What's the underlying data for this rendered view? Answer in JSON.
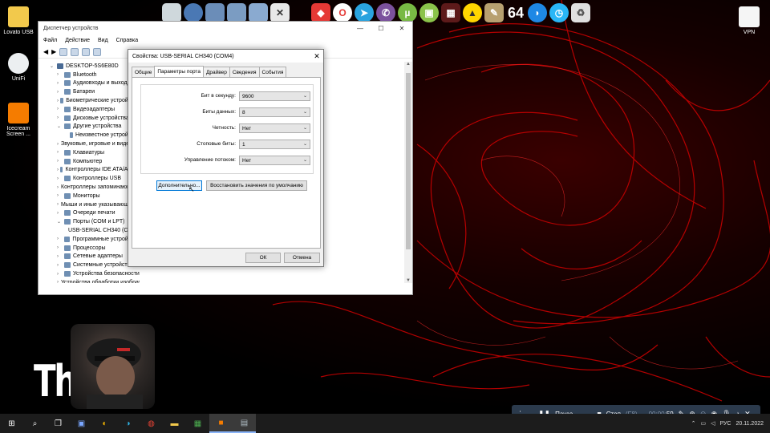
{
  "desktop": {
    "icons": [
      {
        "label": "Lovato USB"
      },
      {
        "label": "UniFi"
      },
      {
        "label": "Icecream Screen ..."
      },
      {
        "label": "VPN"
      }
    ],
    "dock_icons": [
      "files-icon",
      "globe-icon",
      "folder-icon",
      "folder-icon",
      "folder-icon",
      "tools-icon",
      "anydesk-icon",
      "opera-icon",
      "telegram-icon",
      "viber-icon",
      "utorrent-icon",
      "android-icon",
      "film-icon",
      "arrow-icon",
      "scanner-icon",
      "64-icon",
      "shark-icon",
      "timer-icon",
      "recycle-icon"
    ],
    "dock_64_label": "64"
  },
  "devmgr": {
    "title": "Диспетчер устройств",
    "menu": [
      "Файл",
      "Действие",
      "Вид",
      "Справка"
    ],
    "root": "DESKTOP-5S6E80D",
    "tree": [
      {
        "label": "Bluetooth",
        "exp": "›",
        "indent": 1
      },
      {
        "label": "Аудиовходы и выходы",
        "exp": "›",
        "indent": 1
      },
      {
        "label": "Батареи",
        "exp": "›",
        "indent": 1
      },
      {
        "label": "Биометрические устройства",
        "exp": "›",
        "indent": 1
      },
      {
        "label": "Видеоадаптеры",
        "exp": "›",
        "indent": 1
      },
      {
        "label": "Дисковые устройства",
        "exp": "›",
        "indent": 1
      },
      {
        "label": "Другие устройства",
        "exp": "⌄",
        "indent": 1
      },
      {
        "label": "Неизвестное устройство",
        "exp": "",
        "indent": 2
      },
      {
        "label": "Звуковые, игровые и видеоустройства",
        "exp": "›",
        "indent": 1
      },
      {
        "label": "Клавиатуры",
        "exp": "›",
        "indent": 1
      },
      {
        "label": "Компьютер",
        "exp": "›",
        "indent": 1
      },
      {
        "label": "Контроллеры IDE ATA/ATAPI",
        "exp": "›",
        "indent": 1
      },
      {
        "label": "Контроллеры USB",
        "exp": "›",
        "indent": 1
      },
      {
        "label": "Контроллеры запоминающих устройств",
        "exp": "›",
        "indent": 1
      },
      {
        "label": "Мониторы",
        "exp": "›",
        "indent": 1
      },
      {
        "label": "Мыши и иные указывающие устройства",
        "exp": "›",
        "indent": 1
      },
      {
        "label": "Очереди печати",
        "exp": "›",
        "indent": 1
      },
      {
        "label": "Порты (COM и LPT)",
        "exp": "⌄",
        "indent": 1
      },
      {
        "label": "USB-SERIAL CH340 (COM4)",
        "exp": "",
        "indent": 2
      },
      {
        "label": "Программные устройства",
        "exp": "›",
        "indent": 1
      },
      {
        "label": "Процессоры",
        "exp": "›",
        "indent": 1
      },
      {
        "label": "Сетевые адаптеры",
        "exp": "›",
        "indent": 1
      },
      {
        "label": "Системные устройства",
        "exp": "›",
        "indent": 1
      },
      {
        "label": "Устройства безопасности",
        "exp": "›",
        "indent": 1
      },
      {
        "label": "Устройства обработки изображений",
        "exp": "›",
        "indent": 1
      }
    ]
  },
  "dialog": {
    "title": "Свойства: USB-SERIAL CH340 (COM4)",
    "tabs": [
      "Общие",
      "Параметры порта",
      "Драйвер",
      "Сведения",
      "События"
    ],
    "active_tab": 1,
    "settings": [
      {
        "label": "Бит в секунду:",
        "value": "9600"
      },
      {
        "label": "Биты данных:",
        "value": "8"
      },
      {
        "label": "Четность:",
        "value": "Нет"
      },
      {
        "label": "Стоповые биты:",
        "value": "1"
      },
      {
        "label": "Управление потоком:",
        "value": "Нет"
      }
    ],
    "advanced_button": "Дополнительно...",
    "restore_button": "Восстановить значения по умолчанию",
    "ok_button": "ОК",
    "cancel_button": "Отмена"
  },
  "overlay": {
    "big_text": "Th"
  },
  "recorder": {
    "pause_label": "Пауза",
    "stop_label": "Стоп",
    "stop_key": "(F8)",
    "time_prefix": "00:00:",
    "time_seconds": "59"
  },
  "taskbar": {
    "tray_lang": "РУС",
    "tray_date": "20.11.2022"
  },
  "colors": {
    "accent": "#0078d7",
    "recorder_bg": "#2b3a4c",
    "taskbar_bg": "#1c1c1c"
  }
}
